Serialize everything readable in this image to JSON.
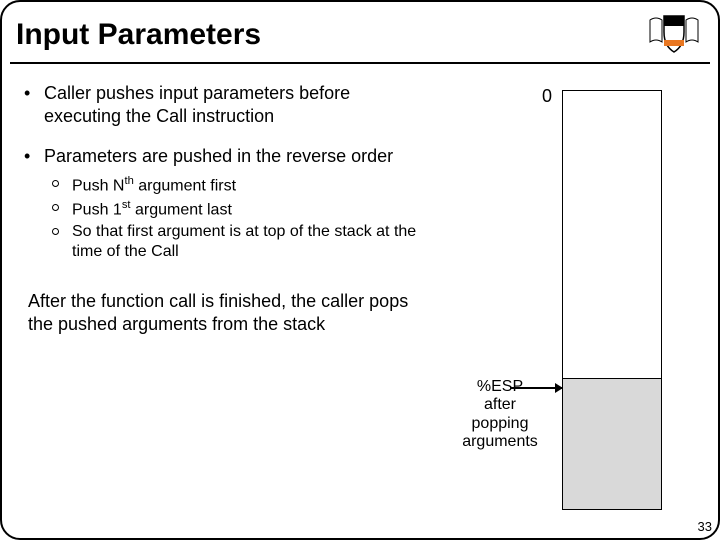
{
  "title": "Input Parameters",
  "bullets": {
    "b1": "Caller pushes input parameters before executing the Call instruction",
    "b2": "Parameters are pushed in the reverse order",
    "sub1_pre": "Push N",
    "sub1_sup": "th",
    "sub1_post": " argument first",
    "sub2_pre": "Push 1",
    "sub2_sup": "st",
    "sub2_post": " argument last",
    "sub3": "So that first argument is at top of the stack at the time of the Call"
  },
  "after": "After the function call is finished, the caller pops the pushed arguments from the stack",
  "diagram": {
    "zero": "0",
    "esp_line1": "%ESP",
    "esp_line2": "after",
    "esp_line3": "popping",
    "esp_line4": "arguments"
  },
  "page": "33"
}
